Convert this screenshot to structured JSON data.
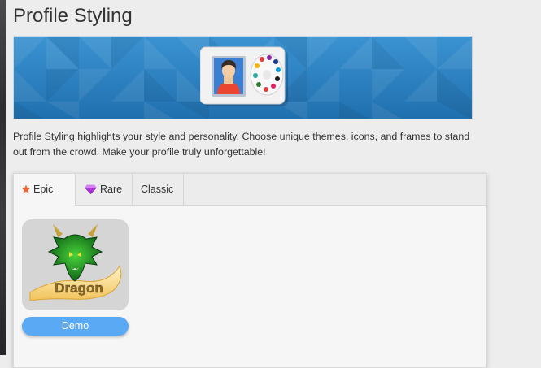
{
  "page": {
    "title": "Profile Styling"
  },
  "banner": {
    "icon": "profile-palette-icon",
    "background_color": "#2a7fbe"
  },
  "description": "Profile Styling highlights your style and personality. Choose unique themes, icons, and frames to stand out from the crowd. Make your profile truly unforgettable!",
  "tabs": [
    {
      "label": "Epic",
      "icon": "star-icon",
      "icon_color": "#e8643c",
      "active": true
    },
    {
      "label": "Rare",
      "icon": "diamond-icon",
      "icon_color": "#b43be0",
      "active": false
    },
    {
      "label": "Classic",
      "icon": "",
      "active": false
    }
  ],
  "items": [
    {
      "image_text": "Dragon",
      "button_label": "Demo",
      "button_color": "#5aa9f5"
    }
  ]
}
